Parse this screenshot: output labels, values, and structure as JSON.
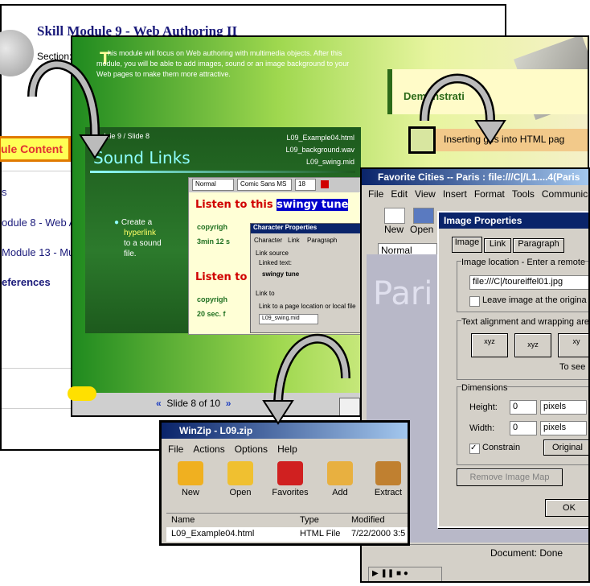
{
  "module_page": {
    "title": "Skill Module 9 - Web Authoring II",
    "section_label": "Section:",
    "module_content": "ule Content",
    "links": [
      "s",
      "odule 8 - Web Au",
      "Module 13 - Mu",
      "eferences"
    ]
  },
  "slide_page": {
    "intro_text": "his module will focus on Web authoring with multimedia objects. After this module, you will be able to add images, sound or an image background to your Web pages to make them more attractive.",
    "intro_initial": "T",
    "demo_heading": "Demonstrati",
    "insert_item": "Inserting ges into HTML pag",
    "slide": {
      "crumb": "Module 9 / Slide 8",
      "files": [
        "L09_Example04.html",
        "L09_background.wav",
        "L09_swing.mid"
      ],
      "title": "Sound Links",
      "bullet": [
        "Create a",
        "hyperlink",
        "to a sound",
        "file."
      ],
      "shot_line1": "Listen to this ",
      "shot_line1_hl": "swingy tune",
      "shot_line2": "Listen to",
      "shot_green": [
        "copyrigh",
        "3min 12 s",
        "copyrigh",
        "20 sec. f"
      ],
      "font_box": "Normal",
      "font_face": "Comic Sans MS",
      "font_size": "18",
      "char_props_title": "Character Properties",
      "char_tabs": [
        "Character",
        "Link",
        "Paragraph"
      ],
      "link_source": "Link source",
      "linked_text_label": "Linked text:",
      "linked_text": "swingy tune",
      "link_to": "Link to",
      "link_to_desc": "Link to a page location or local file",
      "link_value": "L09_swing.mid"
    },
    "slide_nav": "Slide 8 of 10"
  },
  "browser": {
    "title": "Favorite Cities -- Paris : file:///C|/L1....4(Paris",
    "menu": [
      "File",
      "Edit",
      "View",
      "Insert",
      "Format",
      "Tools",
      "Communica"
    ],
    "toolbar": [
      "New",
      "Open"
    ],
    "style_select": "Normal",
    "doc_text": "Pari",
    "status": "Document: Done"
  },
  "image_props": {
    "title": "Image Properties",
    "tabs": [
      "Image",
      "Link",
      "Paragraph"
    ],
    "location_label": "Image location - Enter a remote",
    "location_value": "file:///C|/toureiffel01.jpg",
    "leave_label": "Leave image at the origina",
    "align_label": "Text alignment and wrapping are",
    "align_options": [
      "xyz",
      "xyz",
      "xy"
    ],
    "to_see": "To see",
    "dimensions_label": "Dimensions",
    "height_label": "Height:",
    "height_value": "0",
    "width_label": "Width:",
    "width_value": "0",
    "unit": "pixels",
    "constrain_label": "Constrain",
    "original_btn": "Original",
    "remove_map_btn": "Remove Image Map",
    "ok_btn": "OK"
  },
  "winzip": {
    "title": "WinZip - L09.zip",
    "menu": [
      "File",
      "Actions",
      "Options",
      "Help"
    ],
    "tools": [
      "New",
      "Open",
      "Favorites",
      "Add",
      "Extract"
    ],
    "columns": [
      "Name",
      "Type",
      "Modified"
    ],
    "row": {
      "name": "L09_Example04.html",
      "type": "HTML File",
      "modified": "7/22/2000 3:5"
    }
  }
}
